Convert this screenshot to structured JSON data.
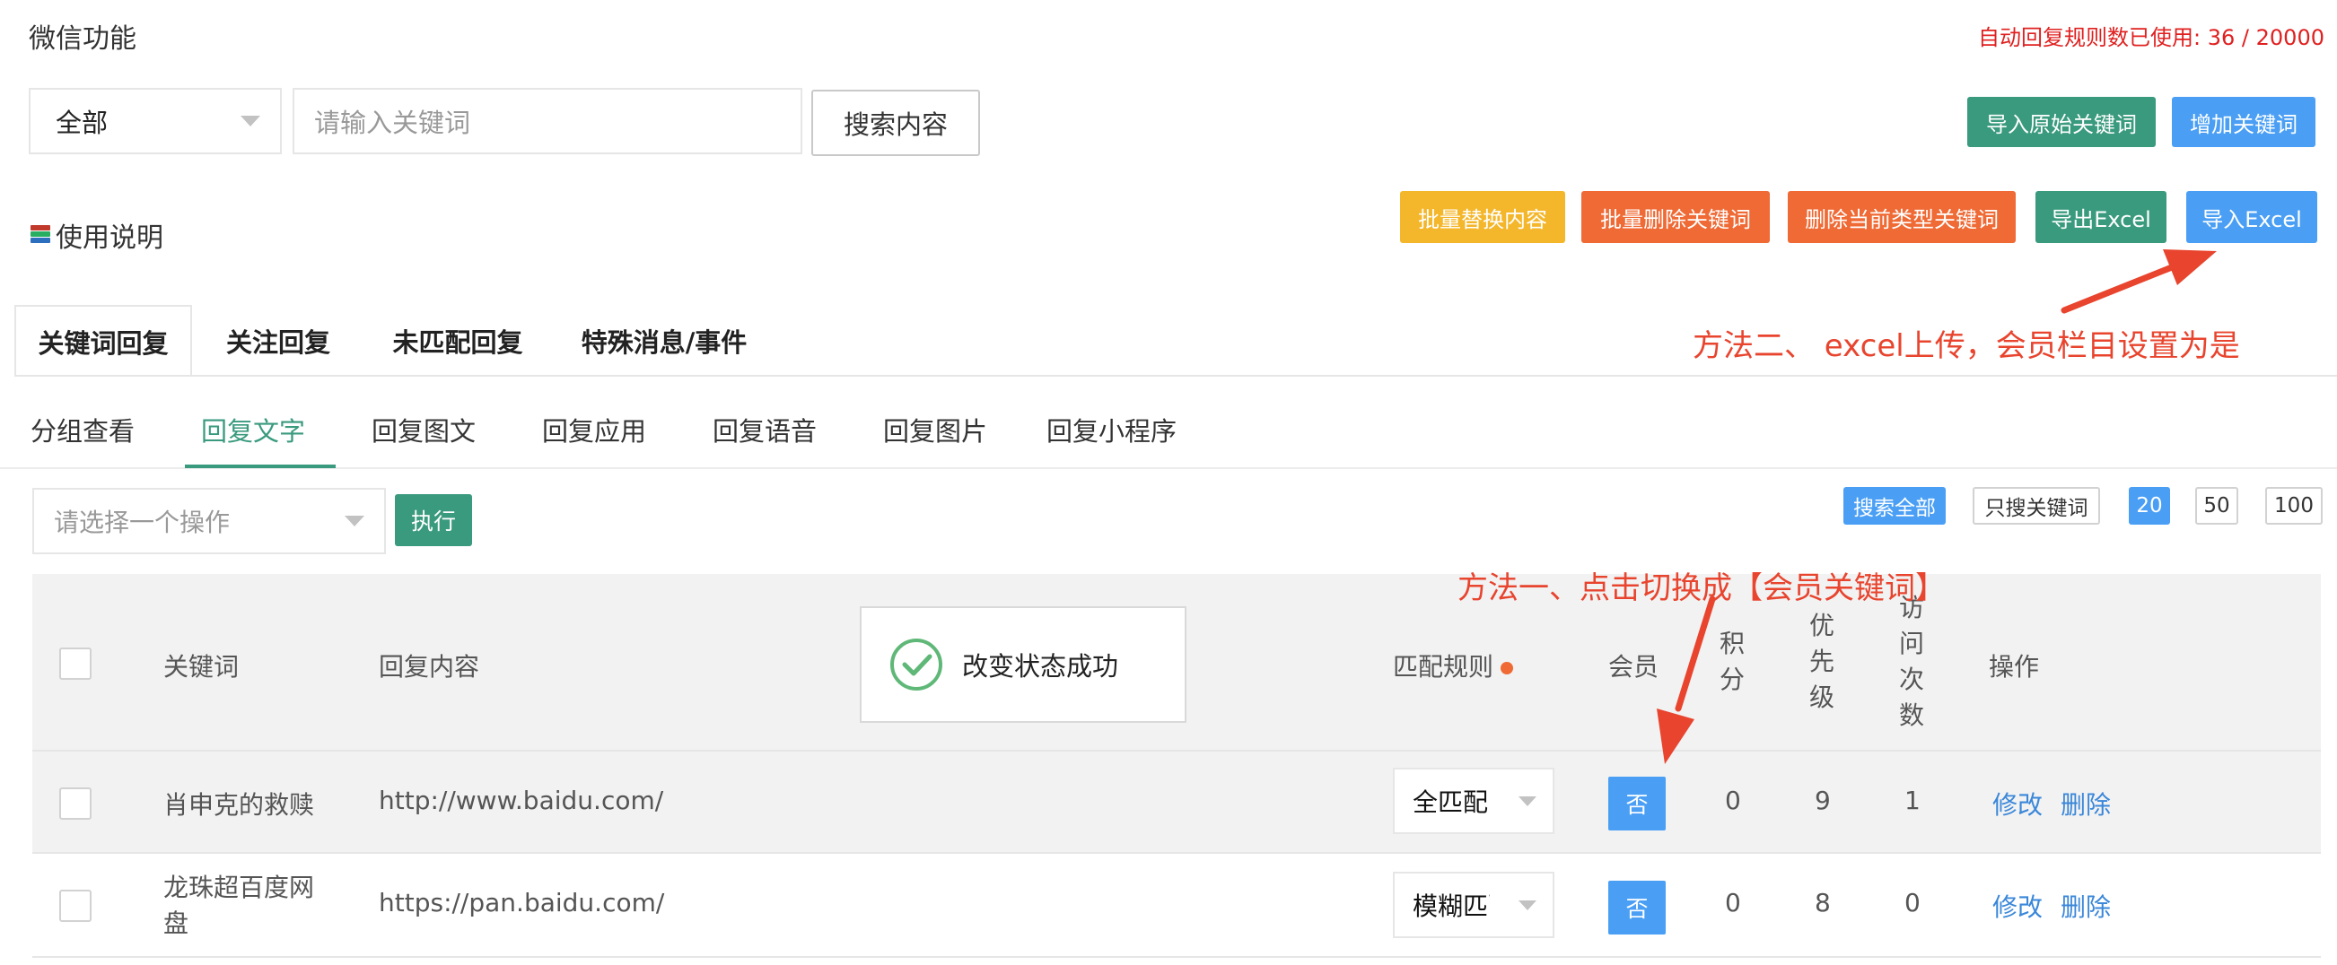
{
  "header": {
    "title": "微信功能",
    "rule_count": "自动回复规则数已使用: 36 / 20000"
  },
  "search": {
    "type_value": "全部",
    "placeholder": "请输入关键词",
    "search_button": "搜索内容"
  },
  "top_actions": {
    "import_original": "导入原始关键词",
    "add_keyword": "增加关键词"
  },
  "bulk_actions": {
    "replace_content": "批量替换内容",
    "delete_keywords": "批量删除关键词",
    "delete_current_type": "删除当前类型关键词",
    "export_excel": "导出Excel",
    "import_excel": "导入Excel"
  },
  "help_link": "使用说明",
  "main_tabs": [
    {
      "label": "关键词回复",
      "active": true
    },
    {
      "label": "关注回复",
      "active": false
    },
    {
      "label": "未匹配回复",
      "active": false
    },
    {
      "label": "特殊消息/事件",
      "active": false
    }
  ],
  "sub_tabs": [
    {
      "label": "分组查看",
      "active": false
    },
    {
      "label": "回复文字",
      "active": true
    },
    {
      "label": "回复图文",
      "active": false
    },
    {
      "label": "回复应用",
      "active": false
    },
    {
      "label": "回复语音",
      "active": false
    },
    {
      "label": "回复图片",
      "active": false
    },
    {
      "label": "回复小程序",
      "active": false
    }
  ],
  "batch": {
    "placeholder": "请选择一个操作",
    "execute": "执行"
  },
  "filters": {
    "search_all": "搜索全部",
    "keyword_only": "只搜关键词",
    "page_sizes": [
      "20",
      "50",
      "100"
    ],
    "active_page_size": "20"
  },
  "table": {
    "headers": {
      "keyword": "关键词",
      "reply": "回复内容",
      "match_rule": "匹配规则",
      "member": "会员",
      "points": "积分",
      "priority": "优先级",
      "visits": "访问次数",
      "actions": "操作"
    },
    "rows": [
      {
        "keyword": "肖申克的救赎",
        "reply": "http://www.baidu.com/",
        "match": "全匹配",
        "member": "否",
        "points": "0",
        "priority": "9",
        "visits": "1",
        "edit": "修改",
        "delete": "删除"
      },
      {
        "keyword": "龙珠超百度网盘",
        "reply": "https://pan.baidu.com/",
        "match": "模糊匹配",
        "member": "否",
        "points": "0",
        "priority": "8",
        "visits": "0",
        "edit": "修改",
        "delete": "删除"
      }
    ]
  },
  "toast": {
    "message": "改变状态成功"
  },
  "annotations": {
    "method_two": "方法二、 excel上传，会员栏目设置为是",
    "method_one": "方法一、点击切换成【会员关键词】"
  },
  "colors": {
    "green": "#3a9a7e",
    "blue": "#4a9ff5",
    "yellow": "#f4b62a",
    "orange": "#ef6a35",
    "annotation_red": "#e8442e",
    "link": "#3a87d9"
  }
}
